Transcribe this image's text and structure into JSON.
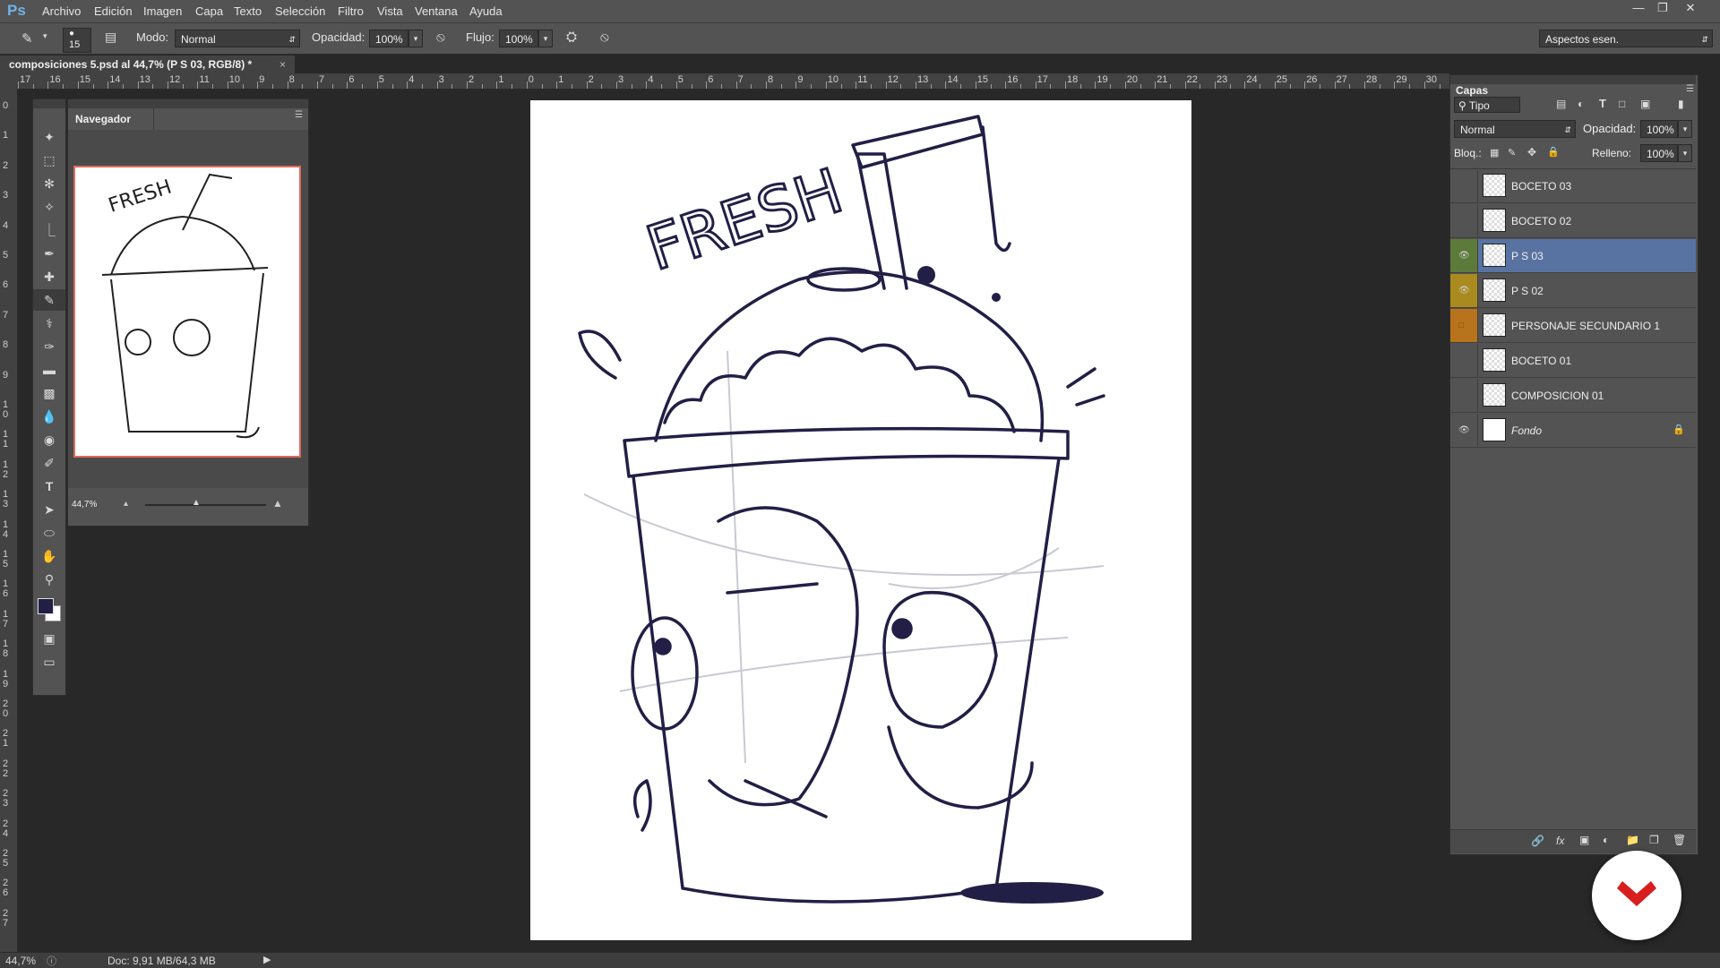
{
  "app": {
    "logo": "Ps"
  },
  "menu": [
    "Archivo",
    "Edición",
    "Imagen",
    "Capa",
    "Texto",
    "Selección",
    "Filtro",
    "Vista",
    "Ventana",
    "Ayuda"
  ],
  "options": {
    "brush_size": "15",
    "mode_label": "Modo:",
    "mode_value": "Normal",
    "opacity_label": "Opacidad:",
    "opacity_value": "100%",
    "flow_label": "Flujo:",
    "flow_value": "100%",
    "workspace": "Aspectos esen."
  },
  "document": {
    "tab_title": "composiciones 5.psd al 44,7% (P S 03, RGB/8) *",
    "close_glyph": "×"
  },
  "ruler": {
    "h_numbers": [
      "17",
      "16",
      "15",
      "14",
      "13",
      "12",
      "11",
      "10",
      "9",
      "8",
      "7",
      "6",
      "5",
      "4",
      "3",
      "2",
      "1",
      "0",
      "1",
      "2",
      "3",
      "4",
      "5",
      "6",
      "7",
      "8",
      "9",
      "10",
      "11",
      "12",
      "13",
      "14",
      "15",
      "16",
      "17",
      "18",
      "19",
      "20",
      "21",
      "22",
      "23",
      "24",
      "25",
      "26",
      "27",
      "28",
      "29",
      "30"
    ],
    "v_numbers": [
      "0",
      "1",
      "2",
      "3",
      "4",
      "5",
      "6",
      "7",
      "8",
      "9",
      "1\n0",
      "1\n1",
      "1\n2",
      "1\n3",
      "1\n4",
      "1\n5",
      "1\n6",
      "1\n7",
      "1\n8",
      "1\n9",
      "2\n0",
      "2\n1",
      "2\n2",
      "2\n3",
      "2\n4",
      "2\n5",
      "2\n6",
      "2\n7"
    ]
  },
  "navigator": {
    "title": "Navegador",
    "zoom": "44,7%"
  },
  "layers": {
    "title": "Capas",
    "filter": "Tipo",
    "blend_mode": "Normal",
    "opacity_label": "Opacidad:",
    "opacity_value": "100%",
    "lock_label": "Bloq.:",
    "fill_label": "Relleno:",
    "fill_value": "100%",
    "items": [
      {
        "name": "BOCETO 03",
        "visible": false,
        "selected": false,
        "tag_color": ""
      },
      {
        "name": "BOCETO 02",
        "visible": false,
        "selected": false,
        "tag_color": ""
      },
      {
        "name": "P S 03",
        "visible": true,
        "selected": true,
        "tag_color": "#5c7a3a"
      },
      {
        "name": "P S 02",
        "visible": true,
        "selected": false,
        "tag_color": "#a88a1f"
      },
      {
        "name": "PERSONAJE SECUNDARIO 1",
        "visible": false,
        "selected": false,
        "tag_color": "#b8731c"
      },
      {
        "name": "BOCETO 01",
        "visible": false,
        "selected": false,
        "tag_color": ""
      },
      {
        "name": "COMPOSICION 01",
        "visible": false,
        "selected": false,
        "tag_color": ""
      },
      {
        "name": "Fondo",
        "visible": true,
        "selected": false,
        "tag_color": "",
        "locked": true
      }
    ],
    "footer_icons": [
      "link-icon",
      "fx-icon",
      "mask-icon",
      "adjustment-icon",
      "group-icon",
      "new-layer-icon",
      "trash-icon"
    ]
  },
  "artwork": {
    "headline": "FRESH"
  },
  "status": {
    "zoom": "44,7%",
    "doc": "Doc: 9,91 MB/64,3 MB"
  },
  "colors": {
    "selected_layer": "#5873a1",
    "brand_badge": "#d81e1e",
    "ink": "#221f46"
  }
}
